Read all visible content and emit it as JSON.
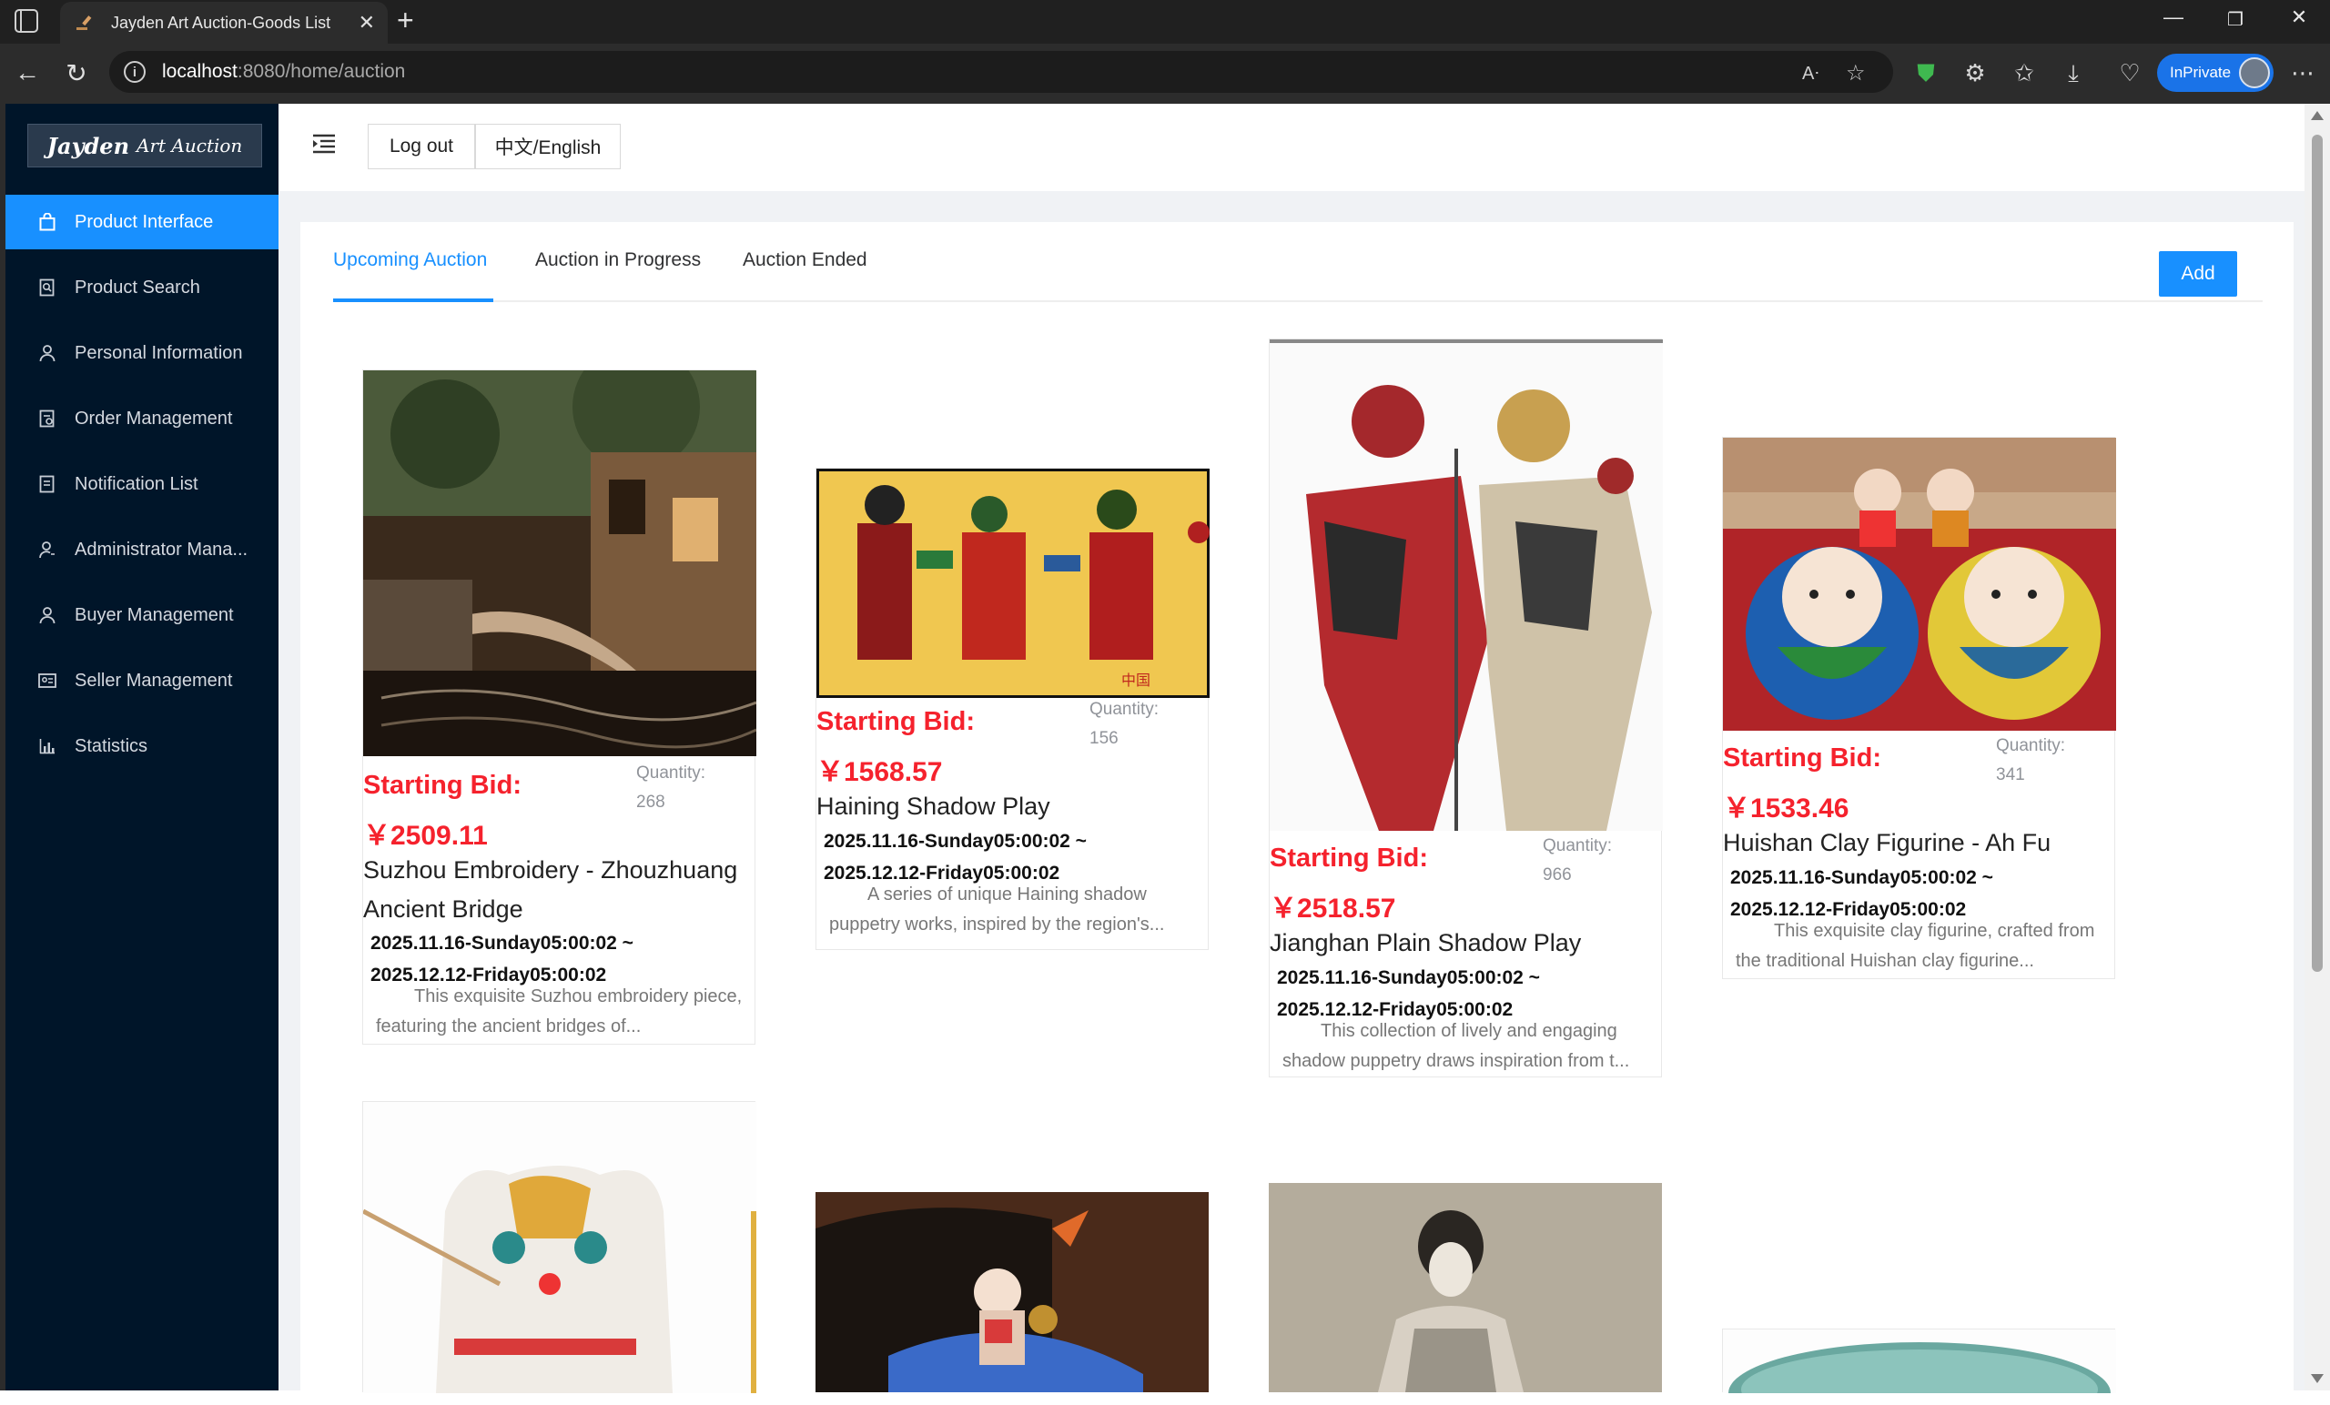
{
  "browser": {
    "tab_title": "Jayden Art Auction-Goods List",
    "url_host": "localhost",
    "url_path": ":8080/home/auction",
    "inprivate_label": "InPrivate"
  },
  "sidebar": {
    "logo_bold": "Jayden",
    "logo_rest": "Art Auction",
    "items": [
      {
        "label": "Product Interface",
        "icon": "bag-icon"
      },
      {
        "label": "Product Search",
        "icon": "search-doc-icon"
      },
      {
        "label": "Personal Information",
        "icon": "user-icon"
      },
      {
        "label": "Order Management",
        "icon": "order-icon"
      },
      {
        "label": "Notification List",
        "icon": "document-icon"
      },
      {
        "label": "Administrator Mana...",
        "icon": "admin-icon"
      },
      {
        "label": "Buyer Management",
        "icon": "user-icon"
      },
      {
        "label": "Seller Management",
        "icon": "id-card-icon"
      },
      {
        "label": "Statistics",
        "icon": "bar-chart-icon"
      }
    ]
  },
  "header": {
    "logout_label": "Log out",
    "lang_label": "中文/English"
  },
  "tabs": {
    "upcoming": "Upcoming Auction",
    "in_progress": "Auction in Progress",
    "ended": "Auction Ended",
    "add_label": "Add"
  },
  "labels": {
    "starting_bid": "Starting Bid:",
    "quantity": "Quantity:"
  },
  "products": [
    {
      "price": "￥2509.11",
      "quantity": "268",
      "name_line1": "Suzhou Embroidery - Zhouzhuang",
      "name_line2": "Ancient Bridge",
      "date_start": "2025.11.16-Sunday05:00:02 ~",
      "date_end": "2025.12.12-Friday05:00:02",
      "desc_line1": "This exquisite Suzhou embroidery piece,",
      "desc_line2": "featuring the ancient bridges of..."
    },
    {
      "price": "￥1568.57",
      "quantity": "156",
      "name_line1": "Haining Shadow Play",
      "date_start": "2025.11.16-Sunday05:00:02 ~",
      "date_end": "2025.12.12-Friday05:00:02",
      "desc_line1": "A series of unique Haining shadow",
      "desc_line2": "puppetry works, inspired by the region's..."
    },
    {
      "price": "￥2518.57",
      "quantity": "966",
      "name_line1": "Jianghan Plain Shadow Play",
      "date_start": "2025.11.16-Sunday05:00:02 ~",
      "date_end": "2025.12.12-Friday05:00:02",
      "desc_line1": "This collection of lively and engaging",
      "desc_line2": "shadow puppetry draws inspiration from t..."
    },
    {
      "price": "￥1533.46",
      "quantity": "341",
      "name_line1": "Huishan Clay Figurine - Ah Fu",
      "date_start": "2025.11.16-Sunday05:00:02 ~",
      "date_end": "2025.12.12-Friday05:00:02",
      "desc_line1": "This exquisite clay figurine, crafted from",
      "desc_line2": "the traditional Huishan clay figurine..."
    }
  ],
  "colors": {
    "sidebar_bg": "#001529",
    "accent": "#1890ff",
    "price_red": "#f5222d"
  }
}
